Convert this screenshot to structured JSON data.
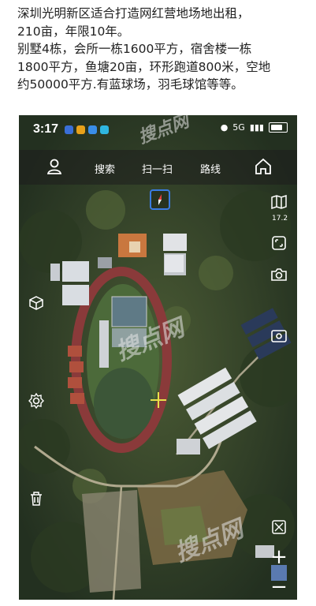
{
  "post": {
    "line1": "深圳光明新区适合打造网红营地场地出租，",
    "line2": "210亩，年限10年。",
    "line3": "别墅4栋，会所一栋1600平方，宿舍楼一栋",
    "line4": "1800平方，鱼塘20亩，环形跑道800米，空地",
    "line5": "约50000平方.有蓝球场，羽毛球馆等等。"
  },
  "status_bar": {
    "time": "3:17",
    "signal_text": "5G"
  },
  "toolbar": {
    "search_label": "搜索",
    "scan_label": "扫一扫",
    "route_label": "路线"
  },
  "map": {
    "zoom_level": "17.2",
    "watermark_1": "搜点网",
    "watermark_2": "搜点网",
    "watermark_3": "搜点网"
  },
  "colors": {
    "compass_accent": "#3a7be0",
    "crosshair": "#e6e24a",
    "track": "#8a3a3a",
    "forest": "#2f4326"
  },
  "icons": [
    "user-icon",
    "home-icon",
    "map-layers-icon",
    "screenshot-icon",
    "camera-icon",
    "3d-cube-icon",
    "camera-switch-icon",
    "settings-icon",
    "delete-icon",
    "measure-icon",
    "zoom-in-icon",
    "zoom-out-icon",
    "compass-icon",
    "crosshair-icon"
  ]
}
